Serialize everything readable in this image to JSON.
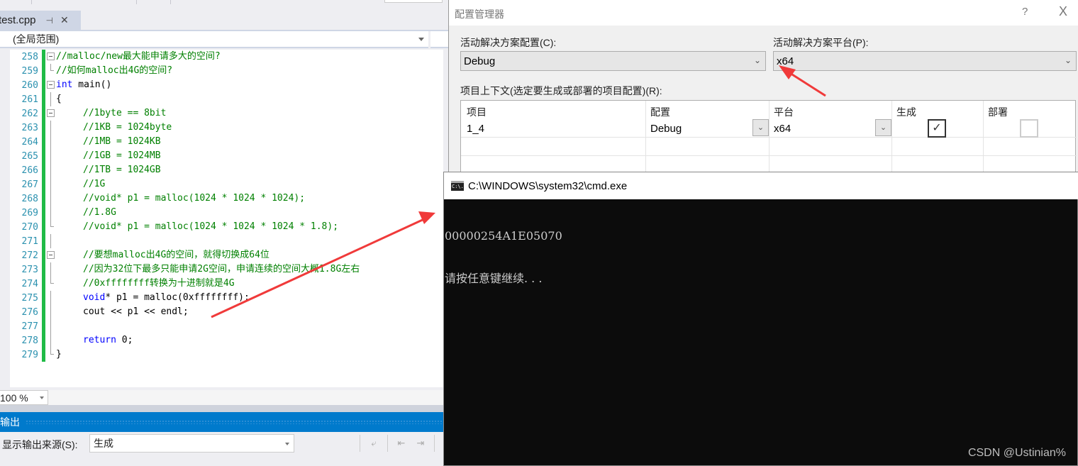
{
  "editor": {
    "tab": {
      "filename": "test.cpp",
      "pin_icon": "pin-icon",
      "close_icon": "close-icon"
    },
    "scope_dropdown": "(全局范围)",
    "lines": [
      {
        "num": "258",
        "fold": "open",
        "segments": [
          {
            "cls": "cmt",
            "text": "//malloc/new最大能申请多大的空间?"
          }
        ]
      },
      {
        "num": "259",
        "fold": "end",
        "segments": [
          {
            "cls": "cmt",
            "text": "//如何malloc出4G的空间?"
          }
        ]
      },
      {
        "num": "260",
        "fold": "open",
        "segments": [
          {
            "cls": "kw",
            "text": "int"
          },
          {
            "cls": "",
            "text": " main()"
          }
        ]
      },
      {
        "num": "261",
        "fold": "line",
        "segments": [
          {
            "cls": "",
            "text": "{"
          }
        ]
      },
      {
        "num": "262",
        "fold": "open",
        "indent": true,
        "segments": [
          {
            "cls": "cmt",
            "text": "//1byte == 8bit"
          }
        ]
      },
      {
        "num": "263",
        "fold": "line",
        "indent": true,
        "segments": [
          {
            "cls": "cmt",
            "text": "//1KB = 1024byte"
          }
        ]
      },
      {
        "num": "264",
        "fold": "line",
        "indent": true,
        "segments": [
          {
            "cls": "cmt",
            "text": "//1MB = 1024KB"
          }
        ]
      },
      {
        "num": "265",
        "fold": "line",
        "indent": true,
        "segments": [
          {
            "cls": "cmt",
            "text": "//1GB = 1024MB"
          }
        ]
      },
      {
        "num": "266",
        "fold": "line",
        "indent": true,
        "segments": [
          {
            "cls": "cmt",
            "text": "//1TB = 1024GB"
          }
        ]
      },
      {
        "num": "267",
        "fold": "line",
        "indent": true,
        "segments": [
          {
            "cls": "cmt",
            "text": "//1G"
          }
        ]
      },
      {
        "num": "268",
        "fold": "line",
        "indent": true,
        "segments": [
          {
            "cls": "cmt",
            "text": "//void* p1 = malloc(1024 * 1024 * 1024);"
          }
        ]
      },
      {
        "num": "269",
        "fold": "line",
        "indent": true,
        "segments": [
          {
            "cls": "cmt",
            "text": "//1.8G"
          }
        ]
      },
      {
        "num": "270",
        "fold": "end",
        "indent": true,
        "segments": [
          {
            "cls": "cmt",
            "text": "//void* p1 = malloc(1024 * 1024 * 1024 * 1.8);"
          }
        ]
      },
      {
        "num": "271",
        "fold": "line",
        "segments": [
          {
            "cls": "",
            "text": ""
          }
        ]
      },
      {
        "num": "272",
        "fold": "open",
        "indent": true,
        "segments": [
          {
            "cls": "cmt",
            "text": "//要想malloc出4G的空间，就得切换成64位"
          }
        ]
      },
      {
        "num": "273",
        "fold": "line",
        "indent": true,
        "segments": [
          {
            "cls": "cmt",
            "text": "//因为32位下最多只能申请2G空间，申请连续的空间大概1.8G左右"
          }
        ]
      },
      {
        "num": "274",
        "fold": "end",
        "indent": true,
        "segments": [
          {
            "cls": "cmt",
            "text": "//0xffffffff转换为十进制就是4G"
          }
        ]
      },
      {
        "num": "275",
        "fold": "line",
        "indent": true,
        "segments": [
          {
            "cls": "kw",
            "text": "void"
          },
          {
            "cls": "",
            "text": "* p1 = malloc(0xffffffff);"
          }
        ]
      },
      {
        "num": "276",
        "fold": "line",
        "indent": true,
        "segments": [
          {
            "cls": "",
            "text": "cout << p1 << endl;"
          }
        ]
      },
      {
        "num": "277",
        "fold": "line",
        "segments": [
          {
            "cls": "",
            "text": ""
          }
        ]
      },
      {
        "num": "278",
        "fold": "line",
        "indent": true,
        "segments": [
          {
            "cls": "kw",
            "text": "return"
          },
          {
            "cls": "",
            "text": " 0;"
          }
        ]
      },
      {
        "num": "279",
        "fold": "end",
        "segments": [
          {
            "cls": "",
            "text": "}"
          }
        ]
      }
    ],
    "zoom_level": "100 %"
  },
  "output_panel": {
    "title": "输出",
    "source_label": "显示输出来源(S):",
    "source_value": "生成"
  },
  "config_manager": {
    "title": "配置管理器",
    "help_label": "?",
    "close_label": "X",
    "active_config_label": "活动解决方案配置(C):",
    "active_config_value": "Debug",
    "active_platform_label": "活动解决方案平台(P):",
    "active_platform_value": "x64",
    "context_label": "项目上下文(选定要生成或部署的项目配置)(R):",
    "columns": [
      "项目",
      "配置",
      "平台",
      "生成",
      "部署"
    ],
    "rows": [
      {
        "project": "1_4",
        "config": "Debug",
        "platform": "x64",
        "build": true,
        "deploy": false
      }
    ],
    "chevron": "⌄"
  },
  "cmd": {
    "title": "C:\\WINDOWS\\system32\\cmd.exe",
    "icon_text": "C:\\.",
    "output_lines": [
      "00000254A1E05070",
      "请按任意键继续. . ."
    ]
  },
  "watermark": "CSDN @Ustinian%",
  "colors": {
    "accent": "#007acc",
    "arrow": "#f03a3a",
    "change_bar": "#1fbb46",
    "comment": "#008000",
    "keyword": "#0000ff",
    "line_number": "#2b91af"
  }
}
